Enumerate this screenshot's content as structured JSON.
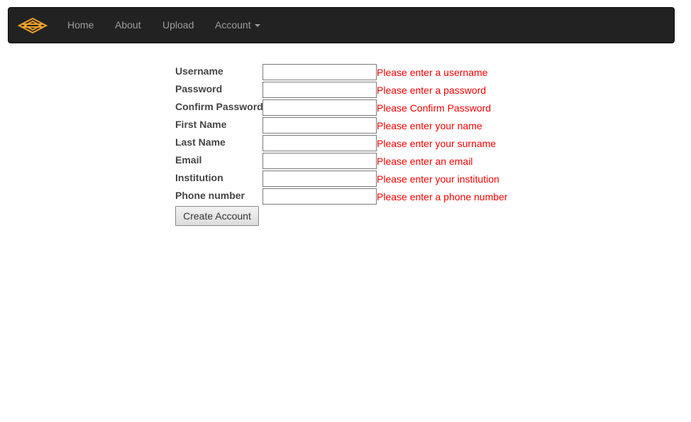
{
  "navbar": {
    "brand_icon": "stacked-layers-logo-icon",
    "brand_color": "#f0a12a",
    "background": "#222222",
    "items": [
      {
        "label": "Home"
      },
      {
        "label": "About"
      },
      {
        "label": "Upload"
      },
      {
        "label": "Account",
        "dropdown": true
      }
    ]
  },
  "form": {
    "fields": [
      {
        "label": "Username",
        "value": "",
        "error": "Please enter a username"
      },
      {
        "label": "Password",
        "value": "",
        "error": "Please enter a password"
      },
      {
        "label": "Confirm Password",
        "value": "",
        "error": "Please Confirm Password"
      },
      {
        "label": "First Name",
        "value": "",
        "error": "Please enter your name"
      },
      {
        "label": "Last Name",
        "value": "",
        "error": "Please enter your surname"
      },
      {
        "label": "Email",
        "value": "",
        "error": "Please enter an email"
      },
      {
        "label": "Institution",
        "value": "",
        "error": "Please enter your institution"
      },
      {
        "label": "Phone number",
        "value": "",
        "error": "Please enter a phone number"
      }
    ],
    "submit_label": "Create Account",
    "error_color": "#ff0000"
  }
}
